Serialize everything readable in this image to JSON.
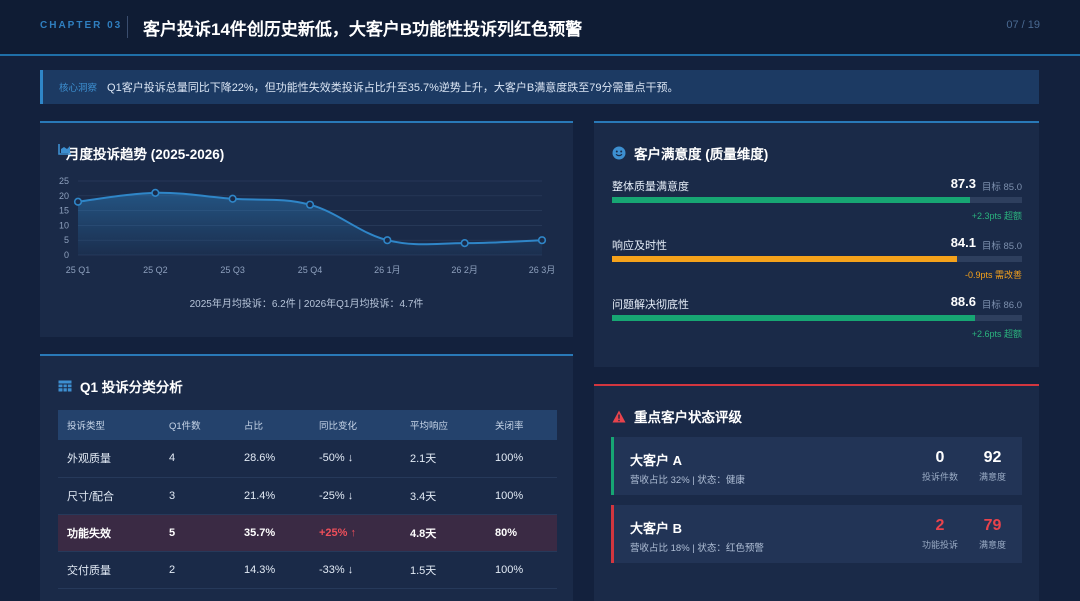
{
  "header": {
    "chapter": "CHAPTER 03",
    "title": "客户投诉14件创历史新低，大客户B功能性投诉列红色预警",
    "page": "07 / 19"
  },
  "insight": {
    "tag": "核心洞察",
    "text": "Q1客户投诉总量同比下降22%，但功能性失效类投诉占比升至35.7%逆势上升，大客户B满意度跌至79分需重点干预。"
  },
  "trend": {
    "title": "月度投诉趋势 (2025-2026)",
    "footer": "2025年月均投诉：6.2件  |  2026年Q1月均投诉：4.7件"
  },
  "chart_data": {
    "type": "area",
    "categories": [
      "25 Q1",
      "25 Q2",
      "25 Q3",
      "25 Q4",
      "26 1月",
      "26 2月",
      "26 3月"
    ],
    "values": [
      18,
      21,
      19,
      17,
      5,
      4,
      5
    ],
    "yticks": [
      0,
      5,
      10,
      15,
      20,
      25
    ],
    "ylim": [
      0,
      25
    ],
    "color": "#2f86c8"
  },
  "satisfaction": {
    "title": "客户满意度 (质量维度)",
    "items": [
      {
        "label": "整体质量满意度",
        "value": "87.3",
        "target": "目标 85.0",
        "note": "+2.3pts 超额",
        "fill": 0.873,
        "color": "#17a673",
        "note_color": "#2bb37e"
      },
      {
        "label": "响应及时性",
        "value": "84.1",
        "target": "目标 85.0",
        "note": "-0.9pts 需改善",
        "fill": 0.841,
        "color": "#f5a21b",
        "note_color": "#f5a21b"
      },
      {
        "label": "问题解决彻底性",
        "value": "88.6",
        "target": "目标 86.0",
        "note": "+2.6pts 超额",
        "fill": 0.886,
        "color": "#17a673",
        "note_color": "#2bb37e"
      }
    ]
  },
  "category": {
    "title": "Q1 投诉分类分析",
    "headers": [
      "投诉类型",
      "Q1件数",
      "占比",
      "同比变化",
      "平均响应",
      "关闭率"
    ],
    "rows": [
      {
        "type": "外观质量",
        "count": "4",
        "share": "28.6%",
        "change": "-50% ↓",
        "dir": "down",
        "resp": "2.1天",
        "close": "100%"
      },
      {
        "type": "尺寸/配合",
        "count": "3",
        "share": "21.4%",
        "change": "-25% ↓",
        "dir": "down",
        "resp": "3.4天",
        "close": "100%"
      },
      {
        "type": "功能失效",
        "count": "5",
        "share": "35.7%",
        "change": "+25% ↑",
        "dir": "up",
        "resp": "4.8天",
        "close": "80%"
      },
      {
        "type": "交付质量",
        "count": "2",
        "share": "14.3%",
        "change": "-33% ↓",
        "dir": "down",
        "resp": "1.5天",
        "close": "100%"
      }
    ]
  },
  "keycust": {
    "title": "重点客户状态评级",
    "customers": [
      {
        "name": "大客户 A",
        "sub": "营收占比 32% | 状态：健康",
        "m1_val": "0",
        "m1_lbl": "投诉件数",
        "m2_val": "92",
        "m2_lbl": "满意度",
        "accent": "#17a673",
        "val_color": "#ffffff"
      },
      {
        "name": "大客户 B",
        "sub": "营收占比 18% | 状态：红色预警",
        "m1_val": "2",
        "m1_lbl": "功能投诉",
        "m2_val": "79",
        "m2_lbl": "满意度",
        "accent": "#d2363f",
        "val_color": "#e8434c"
      }
    ]
  }
}
